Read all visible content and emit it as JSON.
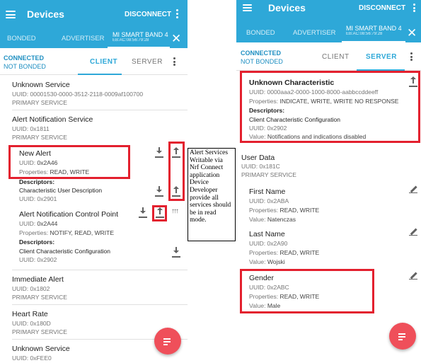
{
  "left": {
    "appbar": {
      "title": "Devices",
      "disconnect": "DISCONNECT"
    },
    "tabs": {
      "bonded": "BONDED",
      "advertiser": "ADVERTISER",
      "device_name": "MI SMART BAND 4",
      "device_mac": "EB:AC:08:56:79:28",
      "close": "✕"
    },
    "subbar": {
      "connected": "CONNECTED",
      "bonded": "NOT BONDED",
      "client": "CLIENT",
      "server": "SERVER"
    },
    "services": [
      {
        "name": "Unknown Service",
        "uuid": "UUID: 00001530-0000-3512-2118-0009af100700",
        "type": "PRIMARY SERVICE"
      },
      {
        "name": "Alert Notification Service",
        "uuid": "UUID: 0x1811",
        "type": "PRIMARY SERVICE"
      }
    ],
    "new_alert": {
      "name": "New Alert",
      "uuid_label": "UUID: ",
      "uuid": "0x2A46",
      "props_label": "Properties: ",
      "props": "READ, WRITE",
      "descriptors": "Descriptors:",
      "desc_name": "Characteristic User Description",
      "desc_uuid": "UUID: 0x2901"
    },
    "control_point": {
      "name": "Alert Notification Control Point",
      "uuid_label": "UUID: ",
      "uuid": "0x2A44",
      "props_label": "Properties: ",
      "props": "NOTIFY, READ, WRITE",
      "descriptors": "Descriptors:",
      "desc_name": "Client Characteristic Configuration",
      "desc_uuid": "UUID: 0x2902"
    },
    "more_services": [
      {
        "name": "Immediate Alert",
        "uuid": "UUID: 0x1802",
        "type": "PRIMARY SERVICE"
      },
      {
        "name": "Heart Rate",
        "uuid": "UUID: 0x180D",
        "type": "PRIMARY SERVICE"
      },
      {
        "name": "Unknown Service",
        "uuid": "UUID: 0xFEE0"
      }
    ]
  },
  "annotation": {
    "text": "Alert Services Writable via Nrf Connect application Device Developer provide all services should be in read mode."
  },
  "right": {
    "appbar": {
      "title": "Devices",
      "disconnect": "DISCONNECT"
    },
    "tabs": {
      "bonded": "BONDED",
      "advertiser": "ADVERTISER",
      "device_name": "MI SMART BAND 4",
      "device_mac": "EB:AC:08:56:79:28",
      "close": "✕"
    },
    "subbar": {
      "connected": "CONNECTED",
      "bonded": "NOT BONDED",
      "client": "CLIENT",
      "server": "SERVER"
    },
    "unknown_char": {
      "name": "Unknown Characteristic",
      "uuid": "UUID: 0000aaa2-0000-1000-8000-aabbccddeeff",
      "props_label": "Properties: ",
      "props": "INDICATE, WRITE, WRITE NO RESPONSE",
      "descriptors": "Descriptors:",
      "desc_name": "Client Characteristic Configuration",
      "desc_uuid": "UUID: 0x2902",
      "value_label": "Value: ",
      "value": "Notifications and indications disabled"
    },
    "user_data": {
      "name": "User Data",
      "uuid": "UUID: 0x181C",
      "type": "PRIMARY SERVICE"
    },
    "fields": [
      {
        "name": "First Name",
        "uuid": "UUID: 0x2ABA",
        "props_label": "Properties: ",
        "props": "READ, WRITE",
        "value_label": "Value: ",
        "value": "Natenczas"
      },
      {
        "name": "Last Name",
        "uuid": "UUID: 0x2A90",
        "props_label": "Properties: ",
        "props": "READ, WRITE",
        "value_label": "Value: ",
        "value": "Wojski"
      },
      {
        "name": "Gender",
        "uuid": "UUID: 0x2ABC",
        "props_label": "Properties: ",
        "props": "READ, WRITE",
        "value_label": "Value: ",
        "value": "Male"
      }
    ]
  },
  "colors": {
    "appbar": "#2ea8d8",
    "accent": "#2ea8d8",
    "highlight": "#e3202e",
    "fab": "#ef4f5a"
  },
  "icons": [
    "menu-icon",
    "more-vert-icon",
    "close-icon",
    "download-icon",
    "upload-icon",
    "multi-upload-icon",
    "pencil-icon",
    "fab-list-icon"
  ]
}
